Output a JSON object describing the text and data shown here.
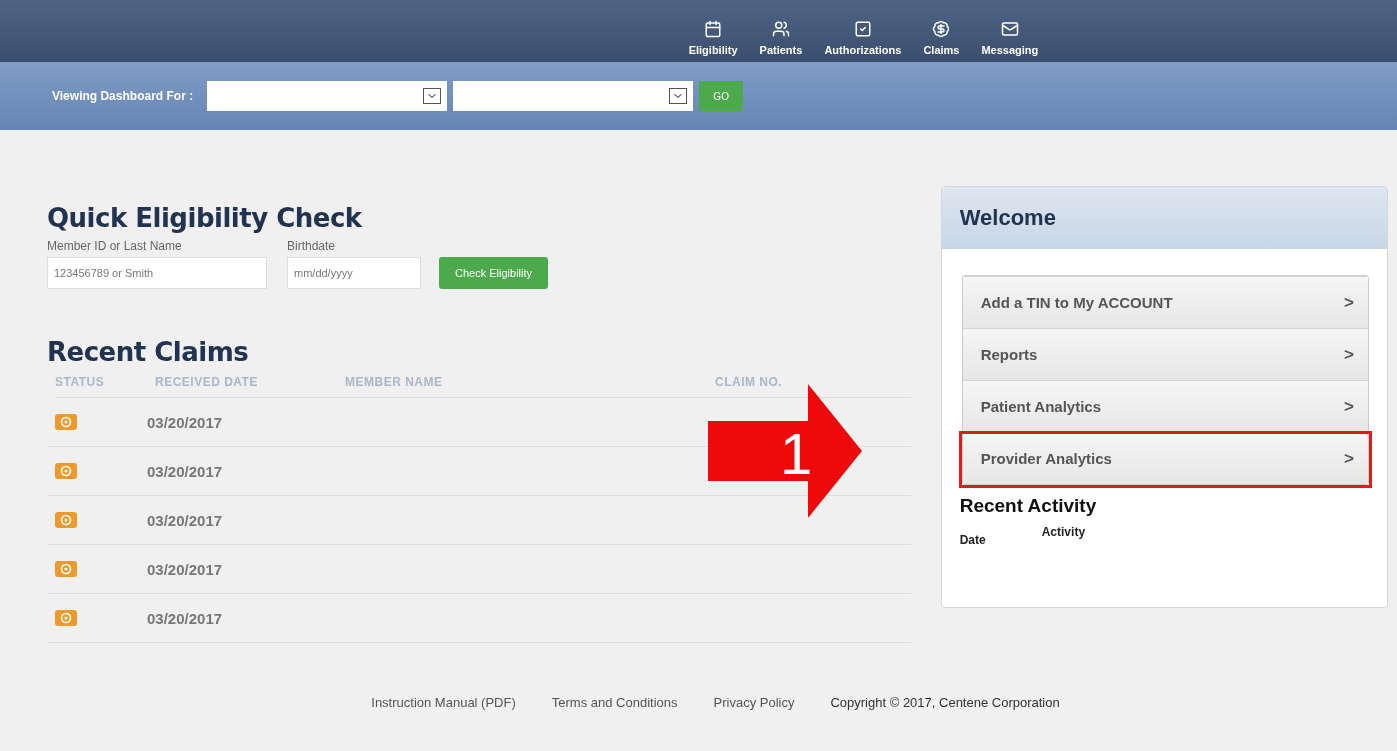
{
  "nav": [
    {
      "kind": "calendar",
      "label": "Eligibility"
    },
    {
      "kind": "patients",
      "label": "Patients"
    },
    {
      "kind": "check",
      "label": "Authorizations"
    },
    {
      "kind": "dollar",
      "label": "Claims"
    },
    {
      "kind": "mail",
      "label": "Messaging"
    }
  ],
  "dashboard_bar": {
    "label": "Viewing Dashboard For :",
    "go": "GO"
  },
  "eligibility": {
    "title": "Quick Eligibility Check",
    "member_label": "Member ID or Last Name",
    "member_placeholder": "123456789 or Smith",
    "birth_label": "Birthdate",
    "birth_placeholder": "mm/dd/yyyy",
    "button": "Check Eligibility"
  },
  "claims": {
    "title": "Recent Claims",
    "columns": [
      "STATUS",
      "RECEIVED DATE",
      "MEMBER NAME",
      "CLAIM NO."
    ],
    "rows": [
      {
        "date": "03/20/2017"
      },
      {
        "date": "03/20/2017"
      },
      {
        "date": "03/20/2017"
      },
      {
        "date": "03/20/2017"
      },
      {
        "date": "03/20/2017"
      }
    ]
  },
  "annotation": {
    "label": "1"
  },
  "welcome": {
    "title": "Welcome",
    "items": [
      {
        "label": "Add a TIN to My ACCOUNT",
        "arrow": ">",
        "highlighted": false
      },
      {
        "label": "Reports",
        "arrow": ">",
        "highlighted": false
      },
      {
        "label": "Patient Analytics",
        "arrow": ">",
        "highlighted": false
      },
      {
        "label": "Provider Analytics",
        "arrow": ">",
        "highlighted": true
      }
    ],
    "activity_title": "Recent Activity",
    "activity_columns": [
      "Date",
      "Activity"
    ]
  },
  "footer": [
    "Instruction Manual (PDF)",
    "Terms and Conditions",
    "Privacy Policy",
    "Copyright © 2017, Centene Corporation"
  ]
}
